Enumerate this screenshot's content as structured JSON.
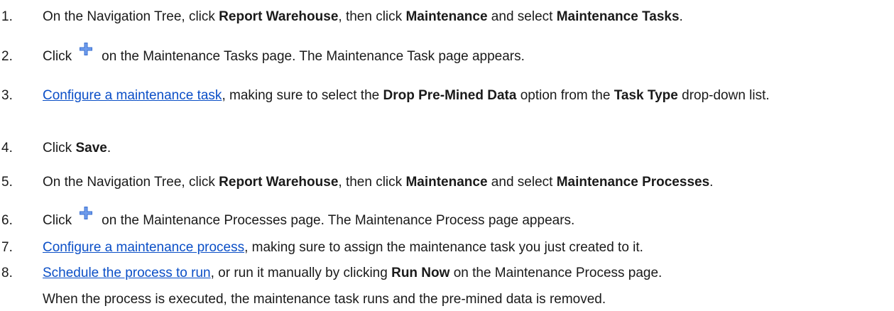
{
  "steps": [
    {
      "number": "1.",
      "t1": "On the Navigation Tree, click ",
      "b1": "Report Warehouse",
      "t2": ", then click ",
      "b2": "Maintenance",
      "t3": " and select ",
      "b3": "Maintenance Tasks",
      "t4": "."
    },
    {
      "number": "2.",
      "t1": "Click",
      "icon": "plus-icon",
      "t2": "on the Maintenance Tasks page. The Maintenance Task page appears."
    },
    {
      "number": "3.",
      "link": "Configure a maintenance task",
      "t1": ", making sure to select the ",
      "b1": "Drop Pre-Mined Data",
      "t2": " option from the ",
      "b2": "Task Type",
      "t3": " drop-down list."
    },
    {
      "number": "4.",
      "t1": "Click ",
      "b1": "Save",
      "t2": "."
    },
    {
      "number": "5.",
      "t1": "On the Navigation Tree, click ",
      "b1": "Report Warehouse",
      "t2": ", then click ",
      "b2": "Maintenance",
      "t3": " and select ",
      "b3": "Maintenance Processes",
      "t4": "."
    },
    {
      "number": "6.",
      "t1": "Click",
      "icon": "plus-icon",
      "t2": "on the Maintenance Processes page. The Maintenance Process page appears."
    },
    {
      "number": "7.",
      "link": "Configure a maintenance process",
      "t1": ", making sure to assign the maintenance task you just created to it."
    },
    {
      "number": "8.",
      "link": "Schedule the process to run",
      "t1": ", or run it manually by clicking ",
      "b1": "Run Now",
      "t2": " on the Maintenance Process page."
    }
  ],
  "note": "When the process is executed, the maintenance task runs and the pre-mined data is removed.",
  "colors": {
    "link": "#0b4fc7",
    "plus_icon": "#3a6fd0",
    "text": "#1a1a1a"
  }
}
